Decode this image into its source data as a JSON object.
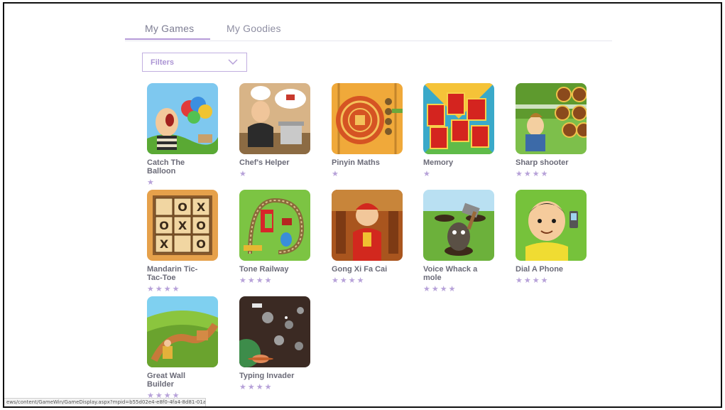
{
  "tabs": [
    {
      "label": "My Games",
      "active": true
    },
    {
      "label": "My Goodies",
      "active": false
    }
  ],
  "filters": {
    "label": "Filters"
  },
  "games": [
    {
      "title": "Catch The Balloon",
      "stars": "★",
      "art": "balloon"
    },
    {
      "title": "Chef's Helper",
      "stars": "★",
      "art": "chef"
    },
    {
      "title": "Pinyin Maths",
      "stars": "★",
      "art": "pinyin"
    },
    {
      "title": "Memory",
      "stars": "★",
      "art": "memory"
    },
    {
      "title": "Sharp shooter",
      "stars": "★★★★",
      "art": "shooter"
    },
    {
      "title": "Mandarin Tic-Tac-Toe",
      "stars": "★★★★",
      "art": "tictactoe"
    },
    {
      "title": "Tone Railway",
      "stars": "★★★★",
      "art": "railway"
    },
    {
      "title": "Gong Xi Fa Cai",
      "stars": "★★★★",
      "art": "gongxi"
    },
    {
      "title": "Voice Whack a mole",
      "stars": "★★★★",
      "art": "mole"
    },
    {
      "title": "Dial A Phone",
      "stars": "★★★★",
      "art": "phone"
    },
    {
      "title": "Great Wall Builder",
      "stars": "★★★★",
      "art": "wall"
    },
    {
      "title": "Typing Invader",
      "stars": "★★★★",
      "art": "invader"
    }
  ],
  "status_url": "ews/content/GameWin/GameDisplay.aspx?mpid=b55d02e4-e8f0-4fa4-8d81-01ae155a7da"
}
